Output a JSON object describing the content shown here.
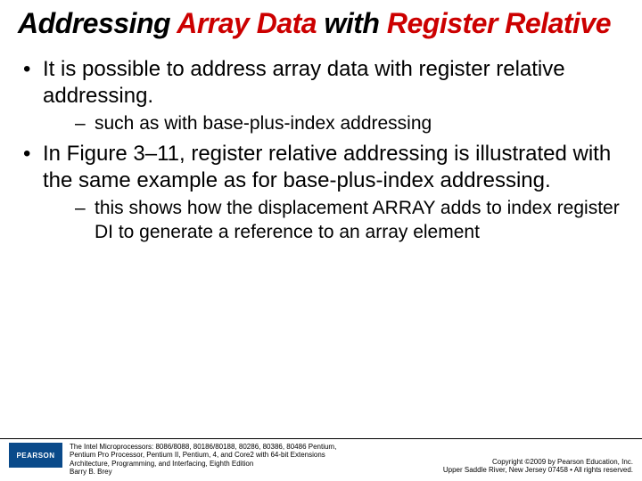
{
  "title": {
    "part1": "Addressing ",
    "accent1": "Array Data",
    "part2": " with ",
    "accent2": "Register Relative"
  },
  "bullets": [
    {
      "text": "It is possible to address array data with register relative addressing.",
      "sub": [
        "such as with base-plus-index addressing"
      ]
    },
    {
      "text": "In Figure 3–11, register relative addressing is illustrated with the same example as for base-plus-index addressing.",
      "sub": [
        "this shows how the displacement ARRAY adds to index register DI to generate a reference to an array element"
      ]
    }
  ],
  "footer": {
    "logo": "PEARSON",
    "book_line1": "The Intel Microprocessors: 8086/8088, 80186/80188, 80286, 80386, 80486 Pentium,",
    "book_line2": "Pentium Pro Processor, Pentium II, Pentium, 4, and Core2 with 64-bit Extensions",
    "book_line3": "Architecture, Programming, and Interfacing, Eighth Edition",
    "book_line4": "Barry B. Brey",
    "copyright_line1": "Copyright ©2009 by Pearson Education, Inc.",
    "copyright_line2": "Upper Saddle River, New Jersey 07458 • All rights reserved."
  }
}
